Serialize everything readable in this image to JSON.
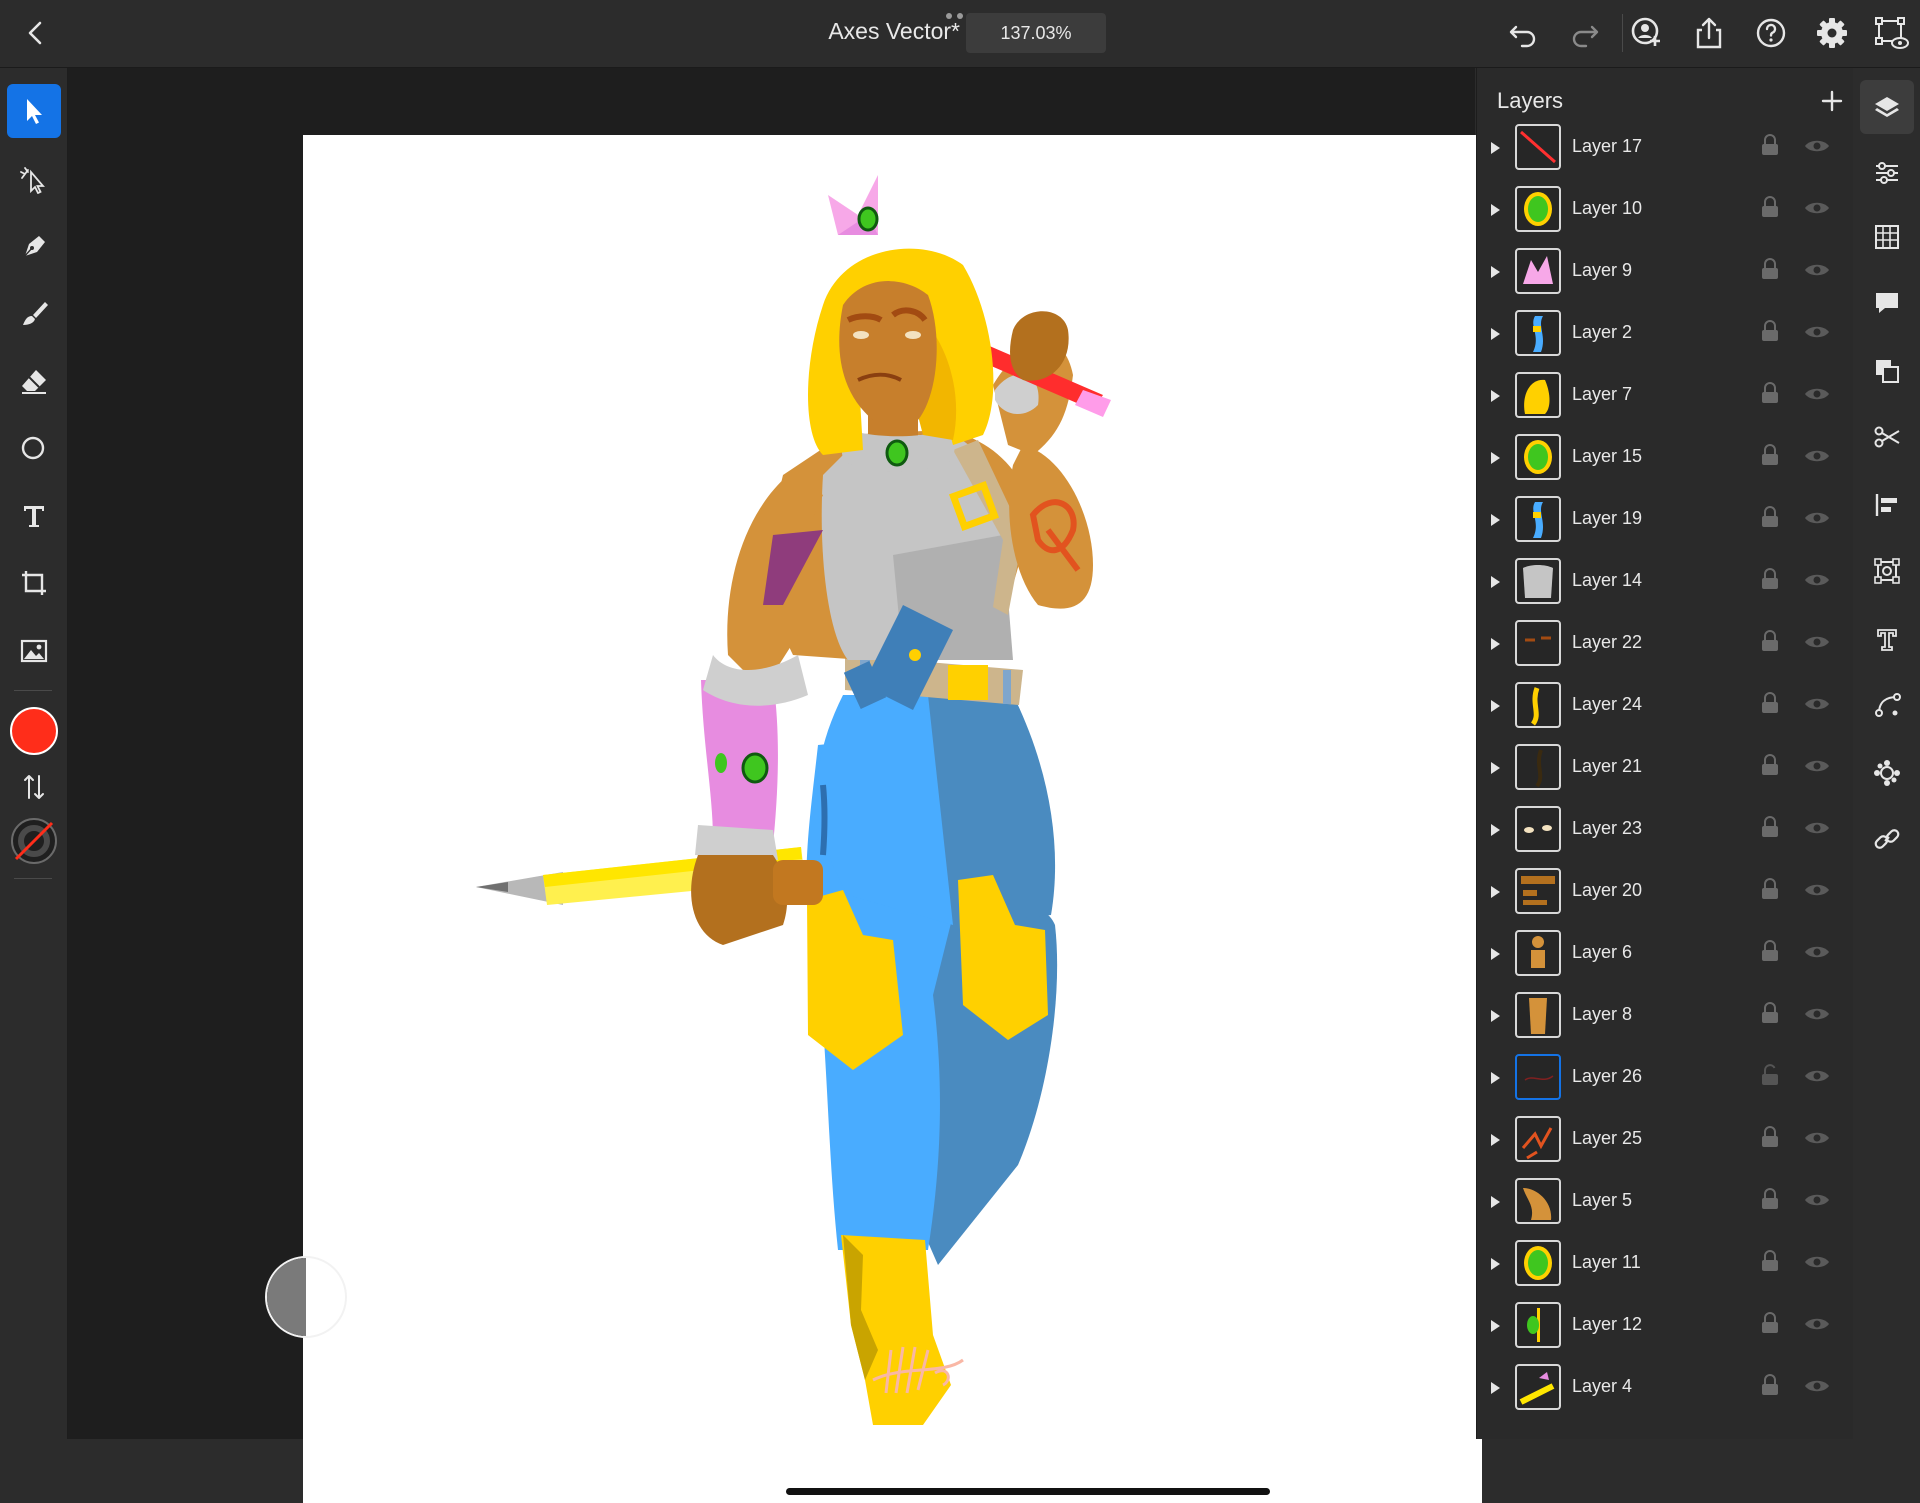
{
  "header": {
    "back_label": "Back",
    "document_title": "Axes Vector*",
    "zoom_level": "137.03%"
  },
  "toolbar": {
    "tools": [
      "select-icon",
      "direct-select-icon",
      "pen-icon",
      "brush-icon",
      "eraser-icon",
      "shape-icon",
      "type-icon",
      "transform-icon",
      "image-icon"
    ],
    "fill_color": "#ff2d1a",
    "stroke_color": "none"
  },
  "layers_panel": {
    "title": "Layers",
    "add_label": "+",
    "layers": [
      {
        "name": "Layer 17",
        "thumb": "red-line"
      },
      {
        "name": "Layer 10",
        "thumb": "green-gem"
      },
      {
        "name": "Layer 9",
        "thumb": "pink-crown"
      },
      {
        "name": "Layer 2",
        "thumb": "blue-arm"
      },
      {
        "name": "Layer 7",
        "thumb": "yellow-hair"
      },
      {
        "name": "Layer 15",
        "thumb": "green-gem"
      },
      {
        "name": "Layer 19",
        "thumb": "blue-arm"
      },
      {
        "name": "Layer 14",
        "thumb": "grey-top"
      },
      {
        "name": "Layer 22",
        "thumb": "brows"
      },
      {
        "name": "Layer 24",
        "thumb": "yellow-strand"
      },
      {
        "name": "Layer 21",
        "thumb": "dark-strand"
      },
      {
        "name": "Layer 23",
        "thumb": "eyes"
      },
      {
        "name": "Layer 20",
        "thumb": "face-shading"
      },
      {
        "name": "Layer 6",
        "thumb": "tan-body"
      },
      {
        "name": "Layer 8",
        "thumb": "tan-leg"
      },
      {
        "name": "Layer 26",
        "thumb": "red-strokes",
        "selected": true,
        "unlocked": true
      },
      {
        "name": "Layer 25",
        "thumb": "red-tattoo"
      },
      {
        "name": "Layer 5",
        "thumb": "tan-arm"
      },
      {
        "name": "Layer 11",
        "thumb": "green-gem"
      },
      {
        "name": "Layer 12",
        "thumb": "half-gem"
      },
      {
        "name": "Layer 4",
        "thumb": "pencil"
      }
    ]
  },
  "right_rail": [
    "layers-icon",
    "properties-icon",
    "grid-icon",
    "comment-icon",
    "arrange-icon",
    "scissors-icon",
    "align-icon",
    "repeat-grid-icon",
    "type-settings-icon",
    "path-icon",
    "glyph-icon",
    "link-icon"
  ]
}
